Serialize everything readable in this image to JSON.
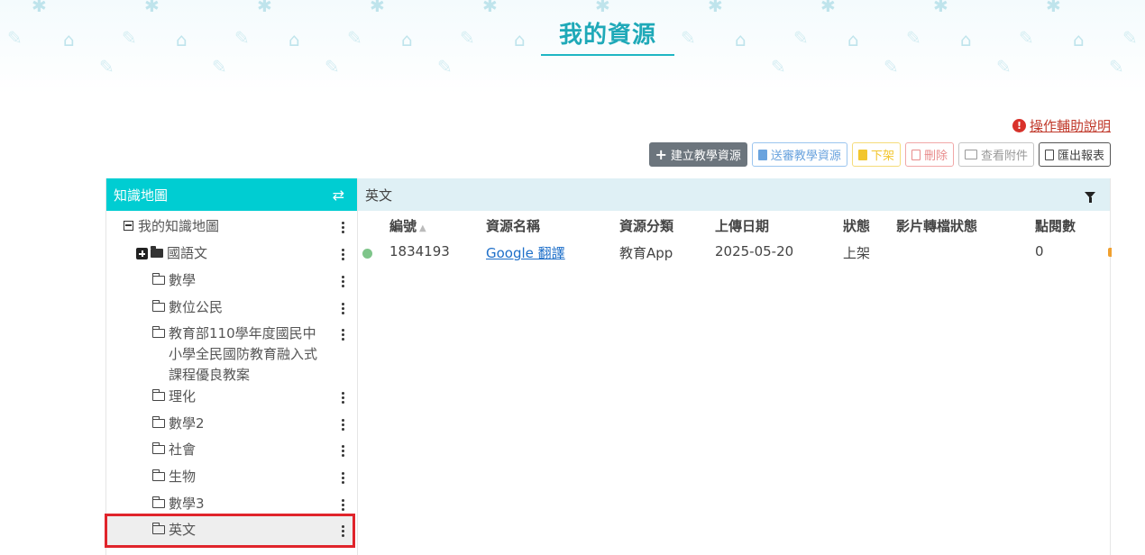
{
  "page": {
    "title": "我的資源"
  },
  "help": {
    "label": "操作輔助說明",
    "icon": "info-circle-icon"
  },
  "toolbar": {
    "create_label": "建立教學資源",
    "review_label": "送審教學資源",
    "offline_label": "下架",
    "delete_label": "刪除",
    "attach_label": "查看附件",
    "export_label": "匯出報表"
  },
  "tree": {
    "header": "知識地圖",
    "root": "我的知識地圖",
    "items": [
      {
        "label": "國語文"
      },
      {
        "label": "數學"
      },
      {
        "label": "數位公民"
      },
      {
        "label_lines": [
          "教育部110學年度國民中",
          "小學全民國防教育融入式",
          "課程優良教案"
        ]
      },
      {
        "label": "理化"
      },
      {
        "label": "數學2"
      },
      {
        "label": "社會"
      },
      {
        "label": "生物"
      },
      {
        "label": "數學3"
      },
      {
        "label": "英文"
      }
    ],
    "selected": "英文"
  },
  "list": {
    "header": "英文",
    "columns": [
      "編號",
      "資源名稱",
      "資源分類",
      "上傳日期",
      "狀態",
      "影片轉檔狀態",
      "點閱數"
    ],
    "rows": [
      {
        "id": "1834193",
        "name": "Google 翻譯",
        "category": "教育App",
        "date": "2025-05-20",
        "status": "上架",
        "video_status": "",
        "views": "0"
      }
    ]
  },
  "colors": {
    "accent": "#00cdd2",
    "title": "#1fa9b8",
    "highlight": "#e0242b",
    "link": "#1e6fc9"
  }
}
